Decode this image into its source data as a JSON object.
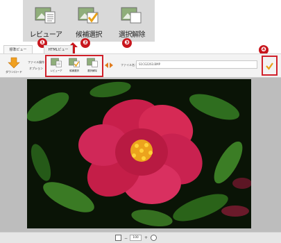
{
  "zoom_panel": {
    "buttons": [
      {
        "label": "レビューア",
        "icon": "viewer-icon"
      },
      {
        "label": "候補選択",
        "icon": "candidate-select-icon"
      },
      {
        "label": "選択解除",
        "icon": "deselect-icon"
      }
    ]
  },
  "badges": [
    "❶",
    "❷",
    "❸",
    "❹"
  ],
  "tabs": [
    {
      "label": "標準ビュー"
    },
    {
      "label": "HTMLビュー"
    }
  ],
  "toolbar": {
    "download_label": "ダウンロード",
    "file_ops_line1": "ファイル操作",
    "file_ops_line2": "オプション",
    "mini_buttons": [
      {
        "label": "レビューア"
      },
      {
        "label": "候補選択"
      },
      {
        "label": "選択解除"
      }
    ],
    "filename_label": "ファイル名：",
    "filename_value": "S1CG2263.BMP"
  },
  "zoom_control": {
    "value": "100"
  },
  "colors": {
    "badge": "#c8161d",
    "highlight_border": "#d0202a",
    "nav_arrow": "#e07b1d",
    "flower": "#d62a55",
    "stamen": "#f2b21a",
    "leaf": "#2e6b1e"
  }
}
